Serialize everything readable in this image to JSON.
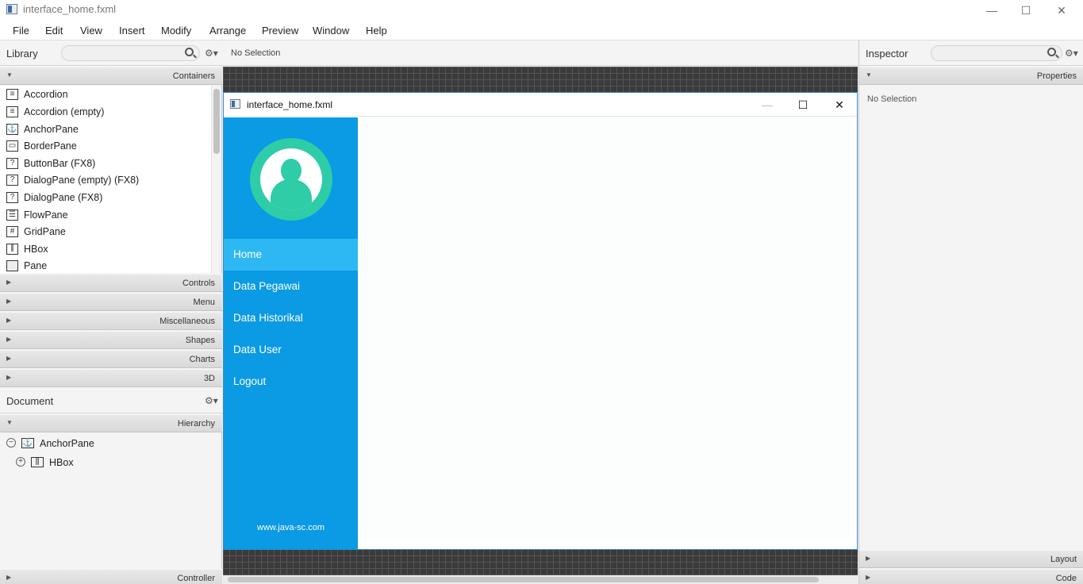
{
  "window": {
    "title": "interface_home.fxml",
    "controls": {
      "minimize": "—",
      "maximize": "☐",
      "close": "✕"
    }
  },
  "menubar": [
    "File",
    "Edit",
    "View",
    "Insert",
    "Modify",
    "Arrange",
    "Preview",
    "Window",
    "Help"
  ],
  "library": {
    "title": "Library",
    "search_placeholder": "",
    "sections": {
      "containers": "Containers",
      "controls": "Controls",
      "menu": "Menu",
      "miscellaneous": "Miscellaneous",
      "shapes": "Shapes",
      "charts": "Charts",
      "threed": "3D"
    },
    "items": [
      {
        "label": "Accordion",
        "icon": "accordion-icon"
      },
      {
        "label": "Accordion  (empty)",
        "icon": "accordion-icon"
      },
      {
        "label": "AnchorPane",
        "icon": "anchor-icon"
      },
      {
        "label": "BorderPane",
        "icon": "border-pane-icon"
      },
      {
        "label": "ButtonBar  (FX8)",
        "icon": "unknown-icon"
      },
      {
        "label": "DialogPane (empty)   (FX8)",
        "icon": "unknown-icon"
      },
      {
        "label": "DialogPane   (FX8)",
        "icon": "unknown-icon"
      },
      {
        "label": "FlowPane",
        "icon": "flow-pane-icon"
      },
      {
        "label": "GridPane",
        "icon": "grid-pane-icon"
      },
      {
        "label": "HBox",
        "icon": "hbox-icon"
      },
      {
        "label": "Pane",
        "icon": "pane-icon"
      }
    ]
  },
  "document": {
    "title": "Document",
    "hierarchy_label": "Hierarchy",
    "controller_label": "Controller",
    "tree": [
      {
        "label": "AnchorPane",
        "icon": "anchor-icon",
        "toggle": "⊖"
      },
      {
        "label": "HBox",
        "icon": "hbox-icon",
        "toggle": "⊕"
      }
    ]
  },
  "content": {
    "selection_status": "No Selection"
  },
  "preview": {
    "title": "interface_home.fxml",
    "nav": [
      "Home",
      "Data Pegawai",
      "Data Historikal",
      "Data User",
      "Logout"
    ],
    "active_nav": "Home",
    "footer": "www.java-sc.com",
    "colors": {
      "sidebar": "#0b9ae4",
      "active": "#2eb8f3",
      "avatar": "#2fcca8"
    }
  },
  "inspector": {
    "title": "Inspector",
    "properties_label": "Properties",
    "selection_status": "No Selection",
    "layout_label": "Layout",
    "code_label": "Code"
  }
}
